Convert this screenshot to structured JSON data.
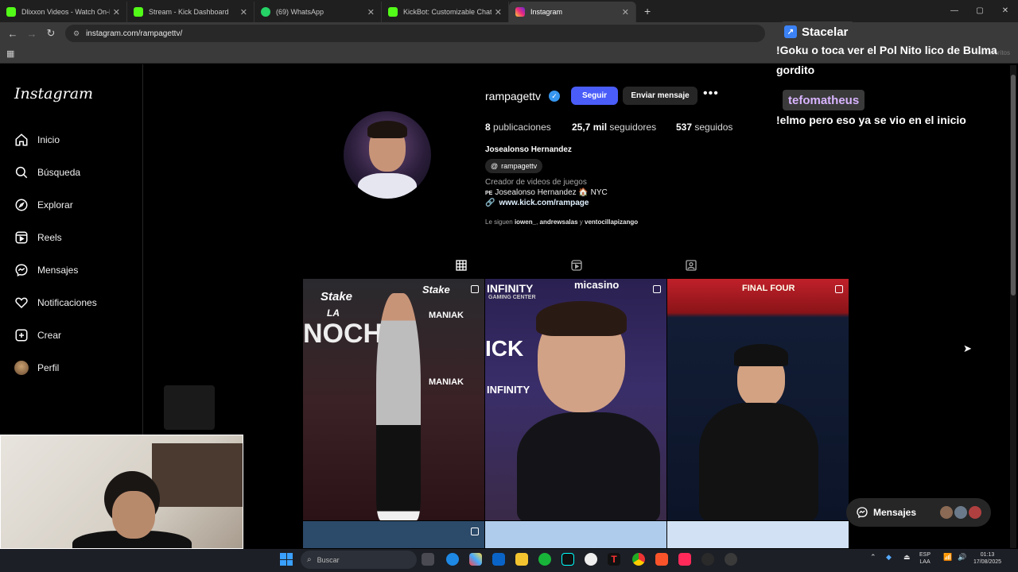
{
  "browser": {
    "tabs": [
      {
        "title": "Dlixxon Videos - Watch On-De",
        "color": "#53fc18"
      },
      {
        "title": "Stream - Kick Dashboard",
        "color": "#53fc18"
      },
      {
        "title": "(69) WhatsApp",
        "color": "#25d366"
      },
      {
        "title": "KickBot: Customizable Chat Bo",
        "color": "#53fc18"
      },
      {
        "title": "Instagram",
        "color": "#e1306c"
      }
    ],
    "url": "instagram.com/rampagettv/",
    "bookmarks_right": "os favoritos"
  },
  "sidebar": {
    "logo": "Instagram",
    "items": [
      {
        "label": "Inicio",
        "icon": "home-icon"
      },
      {
        "label": "Búsqueda",
        "icon": "search-icon"
      },
      {
        "label": "Explorar",
        "icon": "compass-icon"
      },
      {
        "label": "Reels",
        "icon": "reels-icon"
      },
      {
        "label": "Mensajes",
        "icon": "messenger-icon"
      },
      {
        "label": "Notificaciones",
        "icon": "heart-icon"
      },
      {
        "label": "Crear",
        "icon": "plus-square-icon"
      },
      {
        "label": "Perfil",
        "icon": "avatar-icon"
      }
    ]
  },
  "profile": {
    "username": "rampagettv",
    "follow": "Seguir",
    "message": "Enviar mensaje",
    "posts_count": "8",
    "posts_label": "publicaciones",
    "followers_count": "25,7 mil",
    "followers_label": "seguidores",
    "following_count": "537",
    "following_label": "seguidos",
    "full_name": "Josealonso Hernandez",
    "threads_handle": "rampagettv",
    "category": "Creador de videos de juegos",
    "bio_line": "Josealonso Hernandez 🏠 NYC",
    "bio_flag": "PE",
    "link": "www.kick.com/rampage",
    "followed_by_prefix": "Le siguen",
    "followed_by_1": "iowen_",
    "followed_by_2": "andrewsalas",
    "followed_by_sep": "y",
    "followed_by_3": "ventocillapizango"
  },
  "posts": {
    "p1_brand_1": "Stake",
    "p1_brand_2": "MANIAK",
    "p1_brand_3": "NOCHE",
    "p1_brand_4": "LA",
    "p2_brand_1": "INFINITY",
    "p2_brand_2": "GAMING CENTER",
    "p2_brand_3": "ICK",
    "p2_brand_4": "micasino",
    "p3_brand": "FINAL FOUR"
  },
  "chat": {
    "user1": "Stacelar",
    "msg1": "!Goku o toca ver el Pol Nito lico de Bulma gordito",
    "user2": "tefomatheus",
    "msg2": "!elmo pero eso ya se vio en el inicio"
  },
  "messages_pill": "Mensajes",
  "taskbar": {
    "search_placeholder": "Buscar",
    "lang_1": "ESP",
    "lang_2": "LAA",
    "time": "01:13",
    "date": "17/08/2025"
  }
}
